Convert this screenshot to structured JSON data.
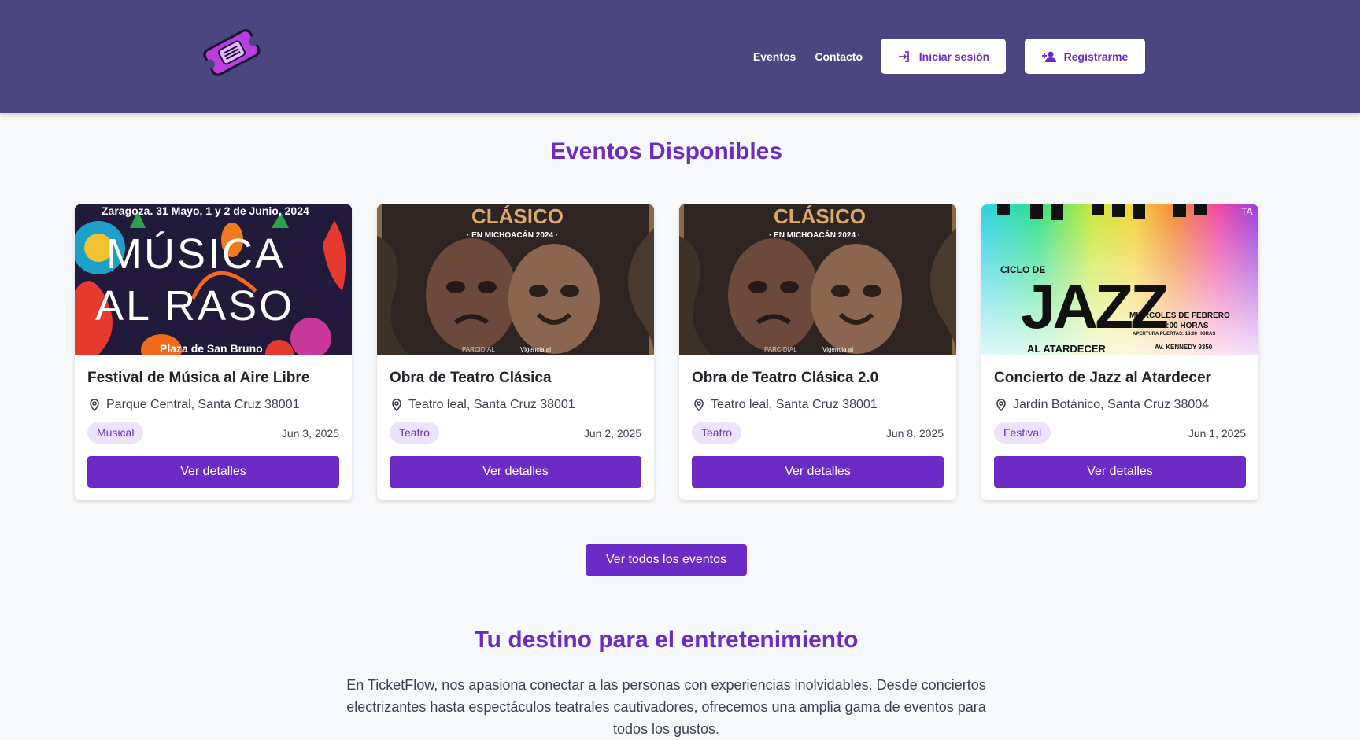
{
  "header": {
    "logo_icon": "ticket-icon",
    "nav": [
      "Eventos",
      "Contacto"
    ],
    "login_label": "Iniciar sesión",
    "register_label": "Registrarme"
  },
  "events_section": {
    "title": "Eventos Disponibles",
    "cards": [
      {
        "poster": {
          "top": "Zaragoza. 31 Mayo, 1 y 2 de Junio, 2024",
          "line1": "MÚSICA",
          "line2": "AL RASO",
          "bottom": "Plaza de San Bruno"
        },
        "title": "Festival de Música al Aire Libre",
        "location": "Parque Central, Santa Cruz 38001",
        "category": "Musical",
        "date": "Jun 3, 2025",
        "button": "Ver detalles"
      },
      {
        "poster": {
          "top": "CLÁSICO",
          "sub": "· EN MICHOACÁN 2024 ·",
          "bottom_left": "PARCIDIAL",
          "bottom_right": "Vigencia al"
        },
        "title": "Obra de Teatro Clásica",
        "location": "Teatro leal, Santa Cruz 38001",
        "category": "Teatro",
        "date": "Jun 2, 2025",
        "button": "Ver detalles"
      },
      {
        "poster": {
          "top": "CLÁSICO",
          "sub": "· EN MICHOACÁN 2024 ·",
          "bottom_left": "PARCIDIAL",
          "bottom_right": "Vigencia al"
        },
        "title": "Obra de Teatro Clásica 2.0",
        "location": "Teatro leal, Santa Cruz 38001",
        "category": "Teatro",
        "date": "Jun 8, 2025",
        "button": "Ver detalles"
      },
      {
        "poster": {
          "pre": "CICLO DE",
          "main": "JAZZ",
          "post": "AL ATARDECER",
          "date": "MIÉRCOLES DE FEBRERO",
          "time": "20:00 HORAS",
          "doors": "APERTURA PUERTAS: 18:00 HORAS",
          "address": "AV. KENNEDY 9350",
          "corner": "TA"
        },
        "title": "Concierto de Jazz al Atardecer",
        "location": "Jardín Botánico, Santa Cruz 38004",
        "category": "Festival",
        "date": "Jun 1, 2025",
        "button": "Ver detalles"
      }
    ],
    "all_button": "Ver todos los eventos"
  },
  "about": {
    "title": "Tu destino para el entretenimiento",
    "text": "En TicketFlow, nos apasiona conectar a las personas con experiencias inolvidables. Desde conciertos electrizantes hasta espectáculos teatrales cautivadores, ofrecemos una amplia gama de eventos para todos los gustos."
  },
  "colors": {
    "header": "#4b4580",
    "accent": "#6c2bc7",
    "badge_bg": "#ece3fb"
  }
}
